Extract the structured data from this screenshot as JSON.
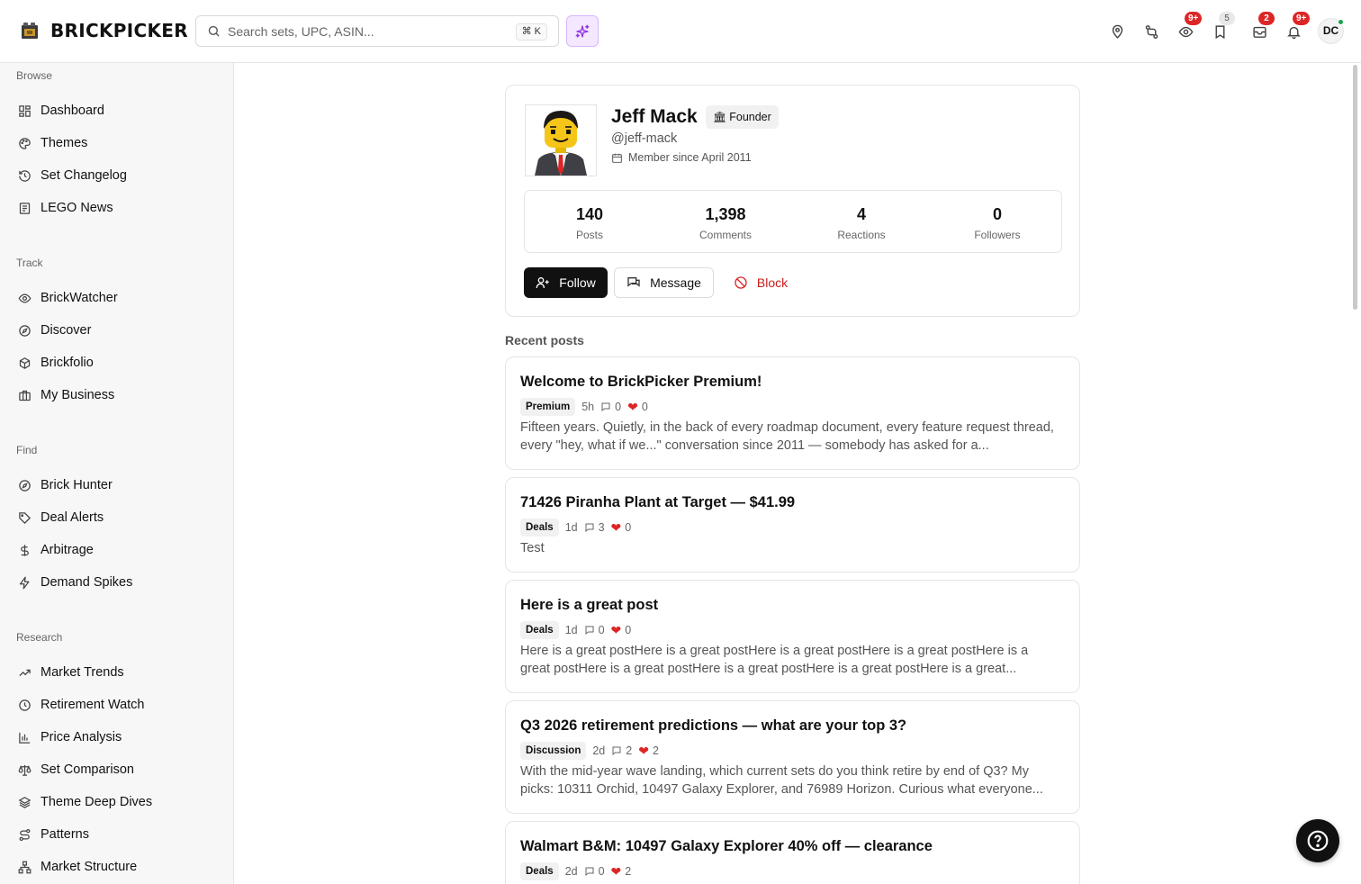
{
  "brand": {
    "name": "BRICKPICKER"
  },
  "search": {
    "placeholder": "Search sets, UPC, ASIN...",
    "shortcut": "⌘ K"
  },
  "header": {
    "icons": [
      {
        "name": "location-pin-icon"
      },
      {
        "name": "compare-icon"
      },
      {
        "name": "watch-eye-icon",
        "badge": "9+"
      },
      {
        "name": "bookmark-icon",
        "badge": "5"
      },
      {
        "name": "inbox-icon",
        "badge": "2"
      },
      {
        "name": "bell-icon",
        "badge": "9+"
      }
    ],
    "user_initials": "DC"
  },
  "sidebar": {
    "sections": [
      {
        "title": "Browse",
        "items": [
          "Dashboard",
          "Themes",
          "Set Changelog",
          "LEGO News"
        ]
      },
      {
        "title": "Track",
        "items": [
          "BrickWatcher",
          "Discover",
          "Brickfolio",
          "My Business"
        ]
      },
      {
        "title": "Find",
        "items": [
          "Brick Hunter",
          "Deal Alerts",
          "Arbitrage",
          "Demand Spikes"
        ]
      },
      {
        "title": "Research",
        "items": [
          "Market Trends",
          "Retirement Watch",
          "Price Analysis",
          "Set Comparison",
          "Theme Deep Dives",
          "Patterns",
          "Market Structure"
        ]
      }
    ]
  },
  "profile": {
    "name": "Jeff Mack",
    "role_badge": "Founder",
    "handle": "@jeff-mack",
    "member_since": "Member since April 2011",
    "stats": [
      {
        "value": "140",
        "label": "Posts"
      },
      {
        "value": "1,398",
        "label": "Comments"
      },
      {
        "value": "4",
        "label": "Reactions"
      },
      {
        "value": "0",
        "label": "Followers"
      }
    ],
    "actions": {
      "follow": "Follow",
      "message": "Message",
      "block": "Block"
    }
  },
  "recent_posts": {
    "title": "Recent posts",
    "items": [
      {
        "title": "Welcome to BrickPicker Premium!",
        "tag": "Premium",
        "age": "5h",
        "comments": "0",
        "reactions": "0",
        "excerpt": "Fifteen years. Quietly, in the back of every roadmap document, every feature request thread, every \"hey, what if we...\" conversation since 2011 — somebody has asked for a..."
      },
      {
        "title": "71426 Piranha Plant at Target — $41.99",
        "tag": "Deals",
        "age": "1d",
        "comments": "3",
        "reactions": "0",
        "excerpt": "Test"
      },
      {
        "title": "Here is a great post",
        "tag": "Deals",
        "age": "1d",
        "comments": "0",
        "reactions": "0",
        "excerpt": "Here is a great postHere is a great postHere is a great postHere is a great postHere is a great postHere is a great postHere is a great postHere is a great postHere is a great..."
      },
      {
        "title": "Q3 2026 retirement predictions — what are your top 3?",
        "tag": "Discussion",
        "age": "2d",
        "comments": "2",
        "reactions": "2",
        "excerpt": "With the mid-year wave landing, which current sets do you think retire by end of Q3? My picks: 10311 Orchid, 10497 Galaxy Explorer, and 76989 Horizon. Curious what everyone..."
      },
      {
        "title": "Walmart B&M: 10497 Galaxy Explorer 40% off — clearance",
        "tag": "Deals",
        "age": "2d",
        "comments": "0",
        "reactions": "2",
        "excerpt": ""
      }
    ]
  },
  "colors": {
    "accent_purple": "#a855f7",
    "danger": "#dc2626",
    "online": "#16a34a"
  }
}
